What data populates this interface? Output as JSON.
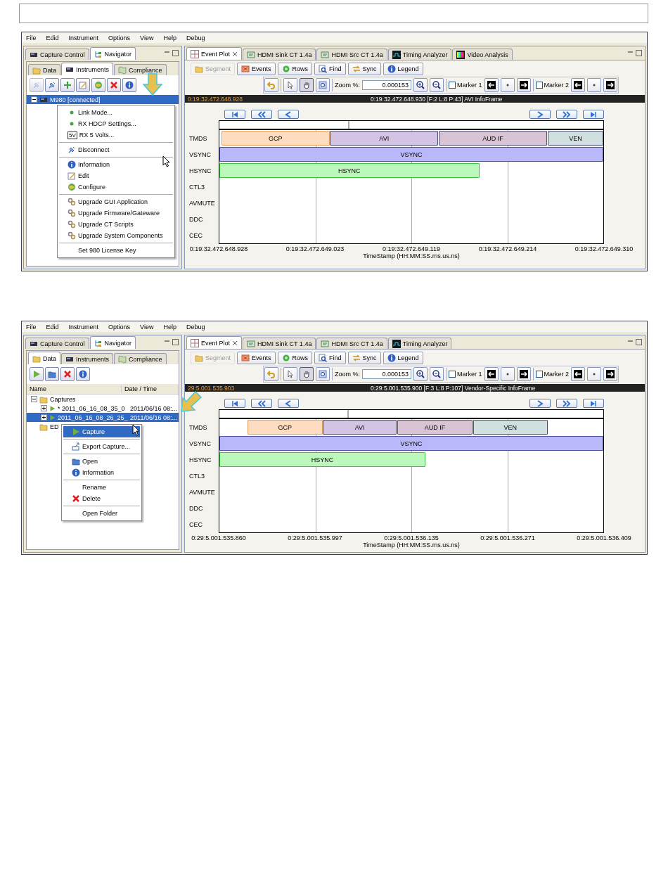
{
  "screens": [
    {
      "menu_bar": [
        "File",
        "Edid",
        "Instrument",
        "Options",
        "View",
        "Help",
        "Debug"
      ],
      "view_tabs": [
        {
          "label": "Capture Control",
          "kind": "device",
          "selected": false
        },
        {
          "label": "Navigator",
          "kind": "tree",
          "selected": true
        }
      ],
      "nav_tabs": [
        {
          "label": "Data",
          "kind": "folder",
          "selected": false
        },
        {
          "label": "Instruments",
          "kind": "device",
          "selected": true
        },
        {
          "label": "Compliance",
          "kind": "map",
          "selected": false
        }
      ],
      "nav_toolbar": [
        {
          "kind": "plug",
          "disabled": true
        },
        {
          "kind": "plug",
          "disabled": false
        },
        {
          "kind": "add",
          "disabled": false
        },
        {
          "kind": "edit",
          "disabled": false
        },
        {
          "kind": "globe",
          "disabled": false
        },
        {
          "kind": "delete",
          "disabled": false
        },
        {
          "kind": "info",
          "disabled": false
        }
      ],
      "tree": [
        {
          "label": "M980 [connected]",
          "kind": "device",
          "expanded": true,
          "selected": true
        }
      ],
      "context_menu": [
        [
          {
            "label": "Link Mode...",
            "kind": "dot",
            "selected": false
          },
          {
            "label": "RX HDCP Settings...",
            "kind": "dot",
            "selected": false
          },
          {
            "label": "RX 5 Volts...",
            "kind": "badge",
            "icon_text": "5V",
            "selected": false
          }
        ],
        [
          {
            "label": "Disconnect",
            "kind": "plug",
            "selected": false
          }
        ],
        [
          {
            "label": "Information",
            "kind": "info",
            "selected": false
          },
          {
            "label": "Edit",
            "kind": "edit",
            "selected": false
          },
          {
            "label": "Configure",
            "kind": "globe",
            "selected": false
          }
        ],
        [
          {
            "label": "Upgrade GUI Application",
            "kind": "gears",
            "selected": false
          },
          {
            "label": "Upgrade Firmware/Gateware",
            "kind": "gears",
            "selected": false
          },
          {
            "label": "Upgrade CT Scripts",
            "kind": "gears",
            "selected": false
          },
          {
            "label": "Upgrade System Components",
            "kind": "gears",
            "selected": false
          }
        ],
        [
          {
            "label": "Set 980 License Key",
            "kind": "none",
            "selected": false
          }
        ]
      ],
      "editor_tabs": [
        {
          "label": "Event Plot",
          "kind": "plot",
          "selected": true,
          "closable": true
        },
        {
          "label": "HDMI Sink CT 1.4a",
          "kind": "doc",
          "selected": false,
          "closable": false
        },
        {
          "label": "HDMI Src CT 1.4a",
          "kind": "doc",
          "selected": false,
          "closable": false
        },
        {
          "label": "Timing Analyzer",
          "kind": "wave",
          "selected": false,
          "closable": false
        },
        {
          "label": "Video Analysis",
          "kind": "colorbars",
          "selected": false,
          "closable": false
        }
      ],
      "plot_toolbar": [
        {
          "label": "Segment",
          "kind": "folder",
          "disabled": true
        },
        {
          "label": "Events",
          "kind": "events",
          "disabled": false
        },
        {
          "label": "Rows",
          "kind": "rows",
          "disabled": false
        },
        {
          "label": "Find",
          "kind": "find",
          "disabled": false
        },
        {
          "label": "Sync",
          "kind": "sync",
          "disabled": false
        },
        {
          "label": "Legend",
          "kind": "info",
          "disabled": false
        }
      ],
      "tool_buttons": [
        {
          "kind": "undo",
          "selected": false
        },
        {
          "kind": "pointer",
          "selected": false
        },
        {
          "kind": "hand",
          "selected": true
        },
        {
          "kind": "zoom-region",
          "selected": false
        }
      ],
      "zoom": {
        "label": "Zoom %:",
        "value": "0.000153"
      },
      "markers": [
        {
          "label": "Marker 1",
          "checked": false
        },
        {
          "label": "Marker 2",
          "checked": false
        }
      ],
      "status": {
        "time": "0:19:32.472.648.928",
        "event": "0:19:32.472.648.930 [F:2 L:8 P:43] AVI InfoFrame"
      },
      "plot": {
        "rows": [
          {
            "label": "TMDS",
            "segments": [
              {
                "label": "GCP",
                "color": "#fddcc0"
              },
              {
                "label": "AVI",
                "color": "#d4c4e4"
              },
              {
                "label": "AUD IF",
                "color": "#d8c4d4"
              },
              {
                "label": "VEN",
                "color": "#d0e0e0"
              }
            ]
          },
          {
            "label": "VSYNC",
            "segments": [
              {
                "label": "VSYNC",
                "color": "#b8b8fa"
              }
            ]
          },
          {
            "label": "HSYNC",
            "segments": [
              {
                "label": "HSYNC",
                "color": "#bcf8bc"
              }
            ]
          },
          {
            "label": "CTL3"
          },
          {
            "label": "AVMUTE"
          },
          {
            "label": "DDC"
          },
          {
            "label": "CEC"
          }
        ],
        "ticks": [
          "0:19:32.472.648.928",
          "0:19:32.472.649.023",
          "0:19:32.472.649.119",
          "0:19:32.472.649.214",
          "0:19:32.472.649.310"
        ],
        "axis_label": "TimeStamp (HH:MM:SS.ms.us.ns)"
      }
    },
    {
      "menu_bar": [
        "File",
        "Edid",
        "Instrument",
        "Options",
        "View",
        "Help",
        "Debug"
      ],
      "view_tabs": [
        {
          "label": "Capture Control",
          "kind": "device",
          "selected": false
        },
        {
          "label": "Navigator",
          "kind": "tree",
          "selected": true
        }
      ],
      "nav_tabs": [
        {
          "label": "Data",
          "kind": "folder",
          "selected": true
        },
        {
          "label": "Instruments",
          "kind": "device",
          "selected": false
        },
        {
          "label": "Compliance",
          "kind": "map",
          "selected": false
        }
      ],
      "nav_toolbar": [
        {
          "kind": "play",
          "disabled": false
        },
        {
          "kind": "open-folder",
          "disabled": false
        },
        {
          "kind": "delete",
          "disabled": false
        },
        {
          "kind": "info",
          "disabled": false
        }
      ],
      "tree_columns": [
        "Name",
        "Date / Time"
      ],
      "tree": [
        {
          "label": "Captures",
          "kind": "folder",
          "expanded": true,
          "selected": false,
          "children": [
            {
              "label": "* 2011_06_16_08_35_0",
              "date": "2011/06/16 08:...",
              "kind": "play",
              "expanded": false,
              "selected": false
            },
            {
              "label": "2011_06_16_08_26_25_",
              "date": "2011/06/16 08:...",
              "kind": "play",
              "expanded": false,
              "selected": true
            }
          ]
        },
        {
          "label": "ED",
          "kind": "folder",
          "selected": false
        }
      ],
      "context_menu": [
        [
          {
            "label": "Capture",
            "kind": "play",
            "selected": true
          }
        ],
        [
          {
            "label": "Export Capture...",
            "kind": "export",
            "selected": false
          }
        ],
        [
          {
            "label": "Open",
            "kind": "open-folder",
            "selected": false
          },
          {
            "label": "Information",
            "kind": "info",
            "selected": false
          }
        ],
        [
          {
            "label": "Rename",
            "kind": "none",
            "selected": false
          },
          {
            "label": "Delete",
            "kind": "delete",
            "selected": false
          }
        ],
        [
          {
            "label": "Open Folder",
            "kind": "none",
            "selected": false
          }
        ]
      ],
      "editor_tabs": [
        {
          "label": "Event Plot",
          "kind": "plot",
          "selected": true,
          "closable": true
        },
        {
          "label": "HDMI Sink CT 1.4a",
          "kind": "doc",
          "selected": false,
          "closable": false
        },
        {
          "label": "HDMI Src CT 1.4a",
          "kind": "doc",
          "selected": false,
          "closable": false
        },
        {
          "label": "Timing Analyzer",
          "kind": "wave",
          "selected": false,
          "closable": false
        }
      ],
      "plot_toolbar": [
        {
          "label": "Segment",
          "kind": "folder",
          "disabled": true
        },
        {
          "label": "Events",
          "kind": "events",
          "disabled": false
        },
        {
          "label": "Rows",
          "kind": "rows",
          "disabled": false
        },
        {
          "label": "Find",
          "kind": "find",
          "disabled": false
        },
        {
          "label": "Sync",
          "kind": "sync",
          "disabled": false
        },
        {
          "label": "Legend",
          "kind": "info",
          "disabled": false
        }
      ],
      "tool_buttons": [
        {
          "kind": "undo",
          "selected": false
        },
        {
          "kind": "pointer",
          "selected": false
        },
        {
          "kind": "hand",
          "selected": true
        },
        {
          "kind": "zoom-region",
          "selected": false
        }
      ],
      "zoom": {
        "label": "Zoom %:",
        "value": "0.000153"
      },
      "markers": [
        {
          "label": "Marker 1",
          "checked": false
        },
        {
          "label": "Marker 2",
          "checked": false
        }
      ],
      "status": {
        "time": "29:5.001.535.903",
        "event": "0:29:5.001.535.900 [F:3 L:8 P:107] Vendor-Specific InfoFrame"
      },
      "plot": {
        "rows": [
          {
            "label": "TMDS",
            "segments": [
              {
                "label": "GCP",
                "color": "#fddcc0"
              },
              {
                "label": "AVI",
                "color": "#d4c4e4"
              },
              {
                "label": "AUD IF",
                "color": "#d8c4d4"
              },
              {
                "label": "VEN",
                "color": "#d0e0e0"
              }
            ]
          },
          {
            "label": "VSYNC",
            "segments": [
              {
                "label": "VSYNC",
                "color": "#b8b8fa"
              }
            ]
          },
          {
            "label": "HSYNC",
            "segments": [
              {
                "label": "HSYNC",
                "color": "#bcf8bc"
              }
            ]
          },
          {
            "label": "CTL3"
          },
          {
            "label": "AVMUTE"
          },
          {
            "label": "DDC"
          },
          {
            "label": "CEC"
          }
        ],
        "ticks": [
          "0:29:5.001.535.860",
          "0:29:5.001.535.997",
          "0:29:5.001.536.135",
          "0:29:5.001.536.271",
          "0:29:5.001.536.409"
        ],
        "axis_label": "TimeStamp (HH:MM:SS.ms.us.ns)"
      }
    }
  ]
}
